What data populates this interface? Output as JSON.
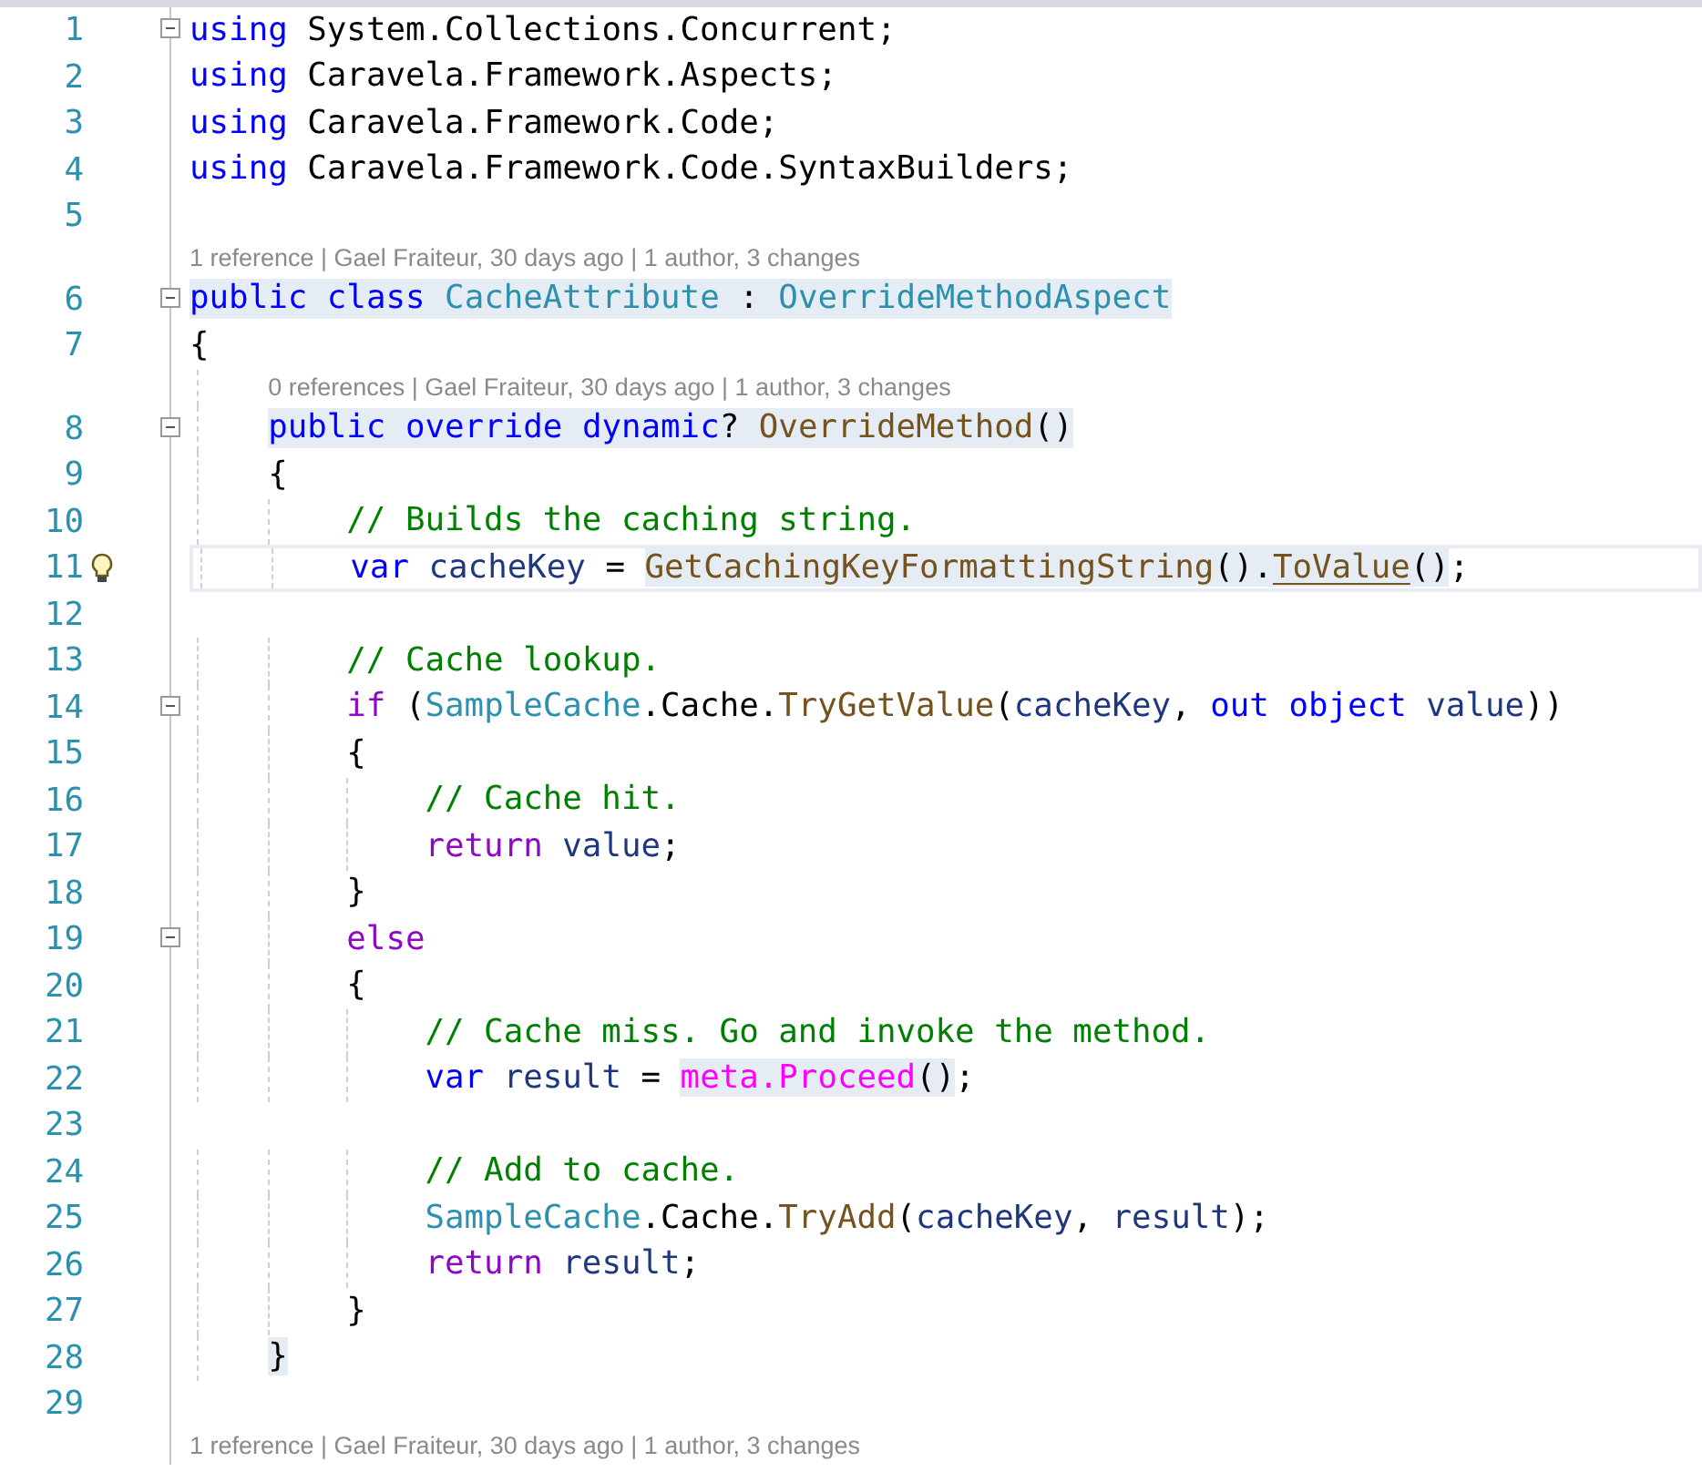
{
  "editor": {
    "lines": [
      {
        "kind": "code",
        "number": "1",
        "fold": true,
        "tokens": [
          {
            "text": "using",
            "kind": "keyword"
          },
          {
            "text": " System.Collections.Concurrent;",
            "kind": "plain"
          }
        ]
      },
      {
        "kind": "code",
        "number": "2",
        "tokens": [
          {
            "text": "using",
            "kind": "keyword"
          },
          {
            "text": " Caravela.Framework.Aspects;",
            "kind": "plain"
          }
        ]
      },
      {
        "kind": "code",
        "number": "3",
        "tokens": [
          {
            "text": "using",
            "kind": "keyword"
          },
          {
            "text": " Caravela.Framework.Code;",
            "kind": "plain"
          }
        ]
      },
      {
        "kind": "code",
        "number": "4",
        "tokens": [
          {
            "text": "using",
            "kind": "keyword"
          },
          {
            "text": " Caravela.Framework.Code.SyntaxBuilders;",
            "kind": "plain"
          }
        ]
      },
      {
        "kind": "code",
        "number": "5"
      },
      {
        "kind": "lens",
        "text": "1 reference | Gael Fraiteur, 30 days ago | 1 author, 3 changes"
      },
      {
        "kind": "code",
        "number": "6",
        "fold": true,
        "highlighted": true,
        "tokens": [
          {
            "text": "public",
            "kind": "keyword"
          },
          {
            "text": " class",
            "kind": "keyword"
          },
          {
            "text": " CacheAttribute",
            "kind": "type"
          },
          {
            "text": " :",
            "kind": "plain"
          },
          {
            "text": " OverrideMethodAspect",
            "kind": "type"
          }
        ]
      },
      {
        "kind": "code",
        "number": "7",
        "tokens": [
          {
            "text": "{",
            "kind": "plain"
          }
        ]
      },
      {
        "kind": "lens",
        "text": "0 references | Gael Fraiteur, 30 days ago | 1 author, 3 changes"
      },
      {
        "kind": "code",
        "number": "8",
        "fold": true,
        "highlighted": true,
        "tokens": [
          {
            "text": "    public",
            "kind": "keyword"
          },
          {
            "text": " override",
            "kind": "keyword"
          },
          {
            "text": " dynamic",
            "kind": "keyword"
          },
          {
            "text": "?",
            "kind": "plain"
          },
          {
            "text": " OverrideMethod",
            "kind": "method"
          },
          {
            "text": "()",
            "kind": "plain"
          }
        ]
      },
      {
        "kind": "code",
        "number": "9",
        "tokens": [
          {
            "text": "    {",
            "kind": "plain"
          }
        ]
      },
      {
        "kind": "code",
        "number": "10",
        "tokens": [
          {
            "text": "        // Builds the caching string.",
            "kind": "comment"
          }
        ]
      },
      {
        "kind": "code",
        "number": "11",
        "current": true,
        "hint": true,
        "tokens": [
          {
            "text": "        var",
            "kind": "keyword"
          },
          {
            "text": " cacheKey",
            "kind": "local"
          },
          {
            "text": " = ",
            "kind": "plain"
          },
          {
            "text": "GetCachingKeyFormattingString",
            "kind": "method",
            "marked": true
          },
          {
            "text": "().",
            "kind": "plain",
            "marked": true
          },
          {
            "text": "ToValue",
            "kind": "method",
            "marked": true,
            "underlined": true
          },
          {
            "text": "()",
            "kind": "plain",
            "marked": true
          },
          {
            "text": ";",
            "kind": "plain"
          }
        ]
      },
      {
        "kind": "code",
        "number": "12"
      },
      {
        "kind": "code",
        "number": "13",
        "tokens": [
          {
            "text": "        // Cache lookup.",
            "kind": "comment"
          }
        ]
      },
      {
        "kind": "code",
        "number": "14",
        "fold": true,
        "tokens": [
          {
            "text": "        if",
            "kind": "control"
          },
          {
            "text": " (",
            "kind": "plain"
          },
          {
            "text": "SampleCache",
            "kind": "type"
          },
          {
            "text": ".Cache.",
            "kind": "plain"
          },
          {
            "text": "TryGetValue",
            "kind": "method"
          },
          {
            "text": "(",
            "kind": "plain"
          },
          {
            "text": "cacheKey",
            "kind": "local"
          },
          {
            "text": ",",
            "kind": "plain"
          },
          {
            "text": " out",
            "kind": "keyword"
          },
          {
            "text": " object",
            "kind": "keyword"
          },
          {
            "text": " value",
            "kind": "local"
          },
          {
            "text": "))",
            "kind": "plain"
          }
        ]
      },
      {
        "kind": "code",
        "number": "15",
        "tokens": [
          {
            "text": "        {",
            "kind": "plain"
          }
        ]
      },
      {
        "kind": "code",
        "number": "16",
        "tokens": [
          {
            "text": "            // Cache hit.",
            "kind": "comment"
          }
        ]
      },
      {
        "kind": "code",
        "number": "17",
        "tokens": [
          {
            "text": "            return",
            "kind": "control"
          },
          {
            "text": " value",
            "kind": "local"
          },
          {
            "text": ";",
            "kind": "plain"
          }
        ]
      },
      {
        "kind": "code",
        "number": "18",
        "tokens": [
          {
            "text": "        }",
            "kind": "plain"
          }
        ]
      },
      {
        "kind": "code",
        "number": "19",
        "fold": true,
        "tokens": [
          {
            "text": "        else",
            "kind": "control"
          }
        ]
      },
      {
        "kind": "code",
        "number": "20",
        "tokens": [
          {
            "text": "        {",
            "kind": "plain"
          }
        ]
      },
      {
        "kind": "code",
        "number": "21",
        "tokens": [
          {
            "text": "            // Cache miss. Go and invoke the method.",
            "kind": "comment"
          }
        ]
      },
      {
        "kind": "code",
        "number": "22",
        "tokens": [
          {
            "text": "            var",
            "kind": "keyword"
          },
          {
            "text": " result",
            "kind": "local"
          },
          {
            "text": " = ",
            "kind": "plain"
          },
          {
            "text": "meta.Proceed",
            "kind": "meta",
            "marked": true
          },
          {
            "text": "()",
            "kind": "plain",
            "marked": true
          },
          {
            "text": ";",
            "kind": "plain"
          }
        ]
      },
      {
        "kind": "code",
        "number": "23"
      },
      {
        "kind": "code",
        "number": "24",
        "tokens": [
          {
            "text": "            // Add to cache.",
            "kind": "comment"
          }
        ]
      },
      {
        "kind": "code",
        "number": "25",
        "tokens": [
          {
            "text": "            SampleCache",
            "kind": "type"
          },
          {
            "text": ".Cache.",
            "kind": "plain"
          },
          {
            "text": "TryAdd",
            "kind": "method"
          },
          {
            "text": "(",
            "kind": "plain"
          },
          {
            "text": "cacheKey",
            "kind": "local"
          },
          {
            "text": ",",
            "kind": "plain"
          },
          {
            "text": " result",
            "kind": "local"
          },
          {
            "text": ");",
            "kind": "plain"
          }
        ]
      },
      {
        "kind": "code",
        "number": "26",
        "tokens": [
          {
            "text": "            return",
            "kind": "control"
          },
          {
            "text": " result",
            "kind": "local"
          },
          {
            "text": ";",
            "kind": "plain"
          }
        ]
      },
      {
        "kind": "code",
        "number": "27",
        "tokens": [
          {
            "text": "        }",
            "kind": "plain"
          }
        ]
      },
      {
        "kind": "code",
        "number": "28",
        "tokens": [
          {
            "text": "    }",
            "kind": "plain",
            "marked": true
          }
        ]
      },
      {
        "kind": "code",
        "number": "29"
      },
      {
        "kind": "lens",
        "text": "1 reference | Gael Fraiteur, 30 days ago | 1 author, 3 changes"
      }
    ]
  }
}
